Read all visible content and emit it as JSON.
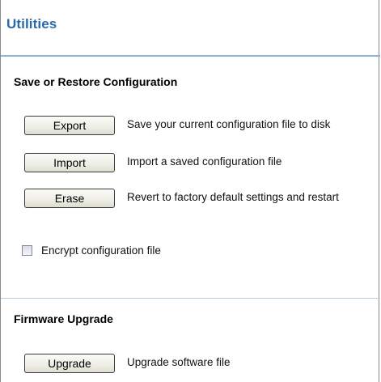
{
  "page": {
    "title": "Utilities"
  },
  "save_restore": {
    "heading": "Save or Restore Configuration",
    "export_label": "Export",
    "export_desc": "Save your current configuration file to disk",
    "import_label": "Import",
    "import_desc": "Import a saved configuration file",
    "erase_label": "Erase",
    "erase_desc": "Revert to factory default settings and restart",
    "encrypt_label": "Encrypt configuration file",
    "encrypt_checked": false
  },
  "firmware": {
    "heading": "Firmware Upgrade",
    "upgrade_label": "Upgrade",
    "upgrade_desc": "Upgrade software file"
  },
  "colors": {
    "title": "#2b6aa8",
    "rule": "#8fb1d6"
  }
}
